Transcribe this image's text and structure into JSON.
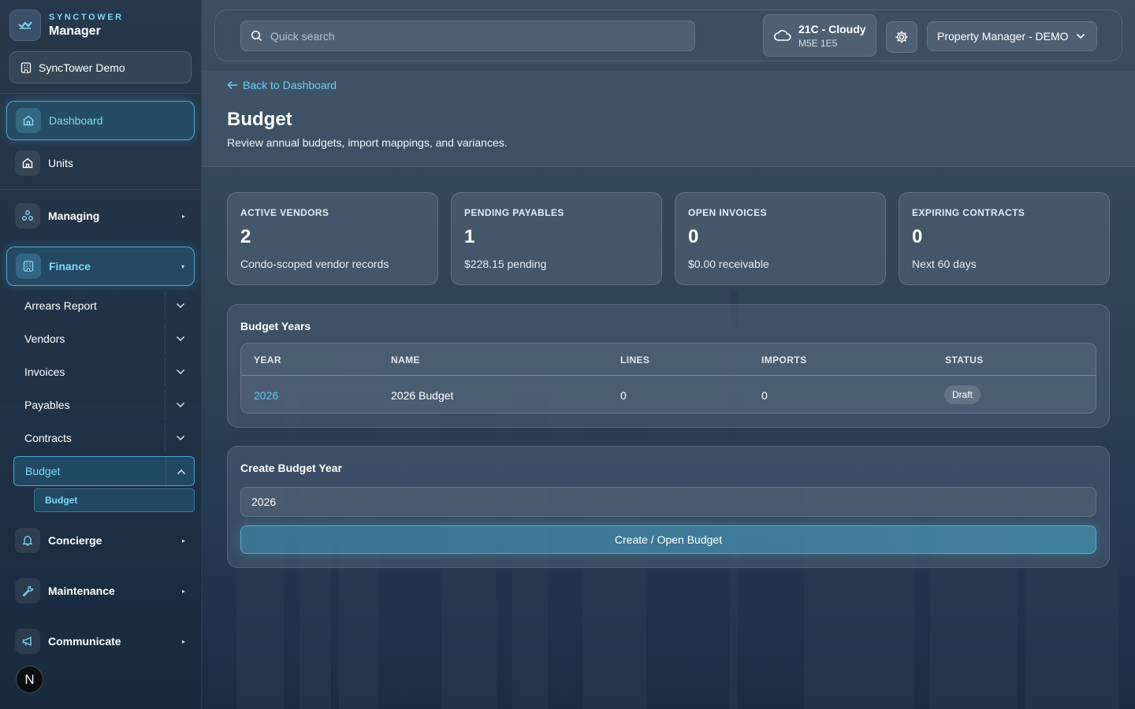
{
  "brand": {
    "kicker": "SYNCTOWER",
    "title": "Manager"
  },
  "org": {
    "label": "SyncTower Demo"
  },
  "nav": {
    "dashboard": "Dashboard",
    "units": "Units",
    "managing": "Managing",
    "finance": "Finance",
    "concierge": "Concierge",
    "maintenance": "Maintenance",
    "communicate": "Communicate"
  },
  "finance_items": [
    "Arrears Report",
    "Vendors",
    "Invoices",
    "Payables",
    "Contracts",
    "Budget"
  ],
  "finance_sub": {
    "budget": "Budget"
  },
  "avatar": {
    "initial": "N"
  },
  "topbar": {
    "search_placeholder": "Quick search",
    "weather_main": "21C - Cloudy",
    "weather_sub": "M5E 1E5",
    "role": "Property Manager - DEMO"
  },
  "header": {
    "back": "Back to Dashboard",
    "title": "Budget",
    "subtitle": "Review annual budgets, import mappings, and variances."
  },
  "stats": [
    {
      "label": "ACTIVE VENDORS",
      "value": "2",
      "note": "Condo-scoped vendor records"
    },
    {
      "label": "PENDING PAYABLES",
      "value": "1",
      "note": "$228.15 pending"
    },
    {
      "label": "OPEN INVOICES",
      "value": "0",
      "note": "$0.00 receivable"
    },
    {
      "label": "EXPIRING CONTRACTS",
      "value": "0",
      "note": "Next 60 days"
    }
  ],
  "budget_years": {
    "title": "Budget Years",
    "columns": [
      "YEAR",
      "NAME",
      "LINES",
      "IMPORTS",
      "STATUS"
    ],
    "rows": [
      {
        "year": "2026",
        "name": "2026 Budget",
        "lines": "0",
        "imports": "0",
        "status": "Draft"
      }
    ]
  },
  "create": {
    "title": "Create Budget Year",
    "year_value": "2026",
    "button": "Create / Open Budget"
  },
  "colors": {
    "accent": "#6fd0f0",
    "background": "#2c4054"
  }
}
